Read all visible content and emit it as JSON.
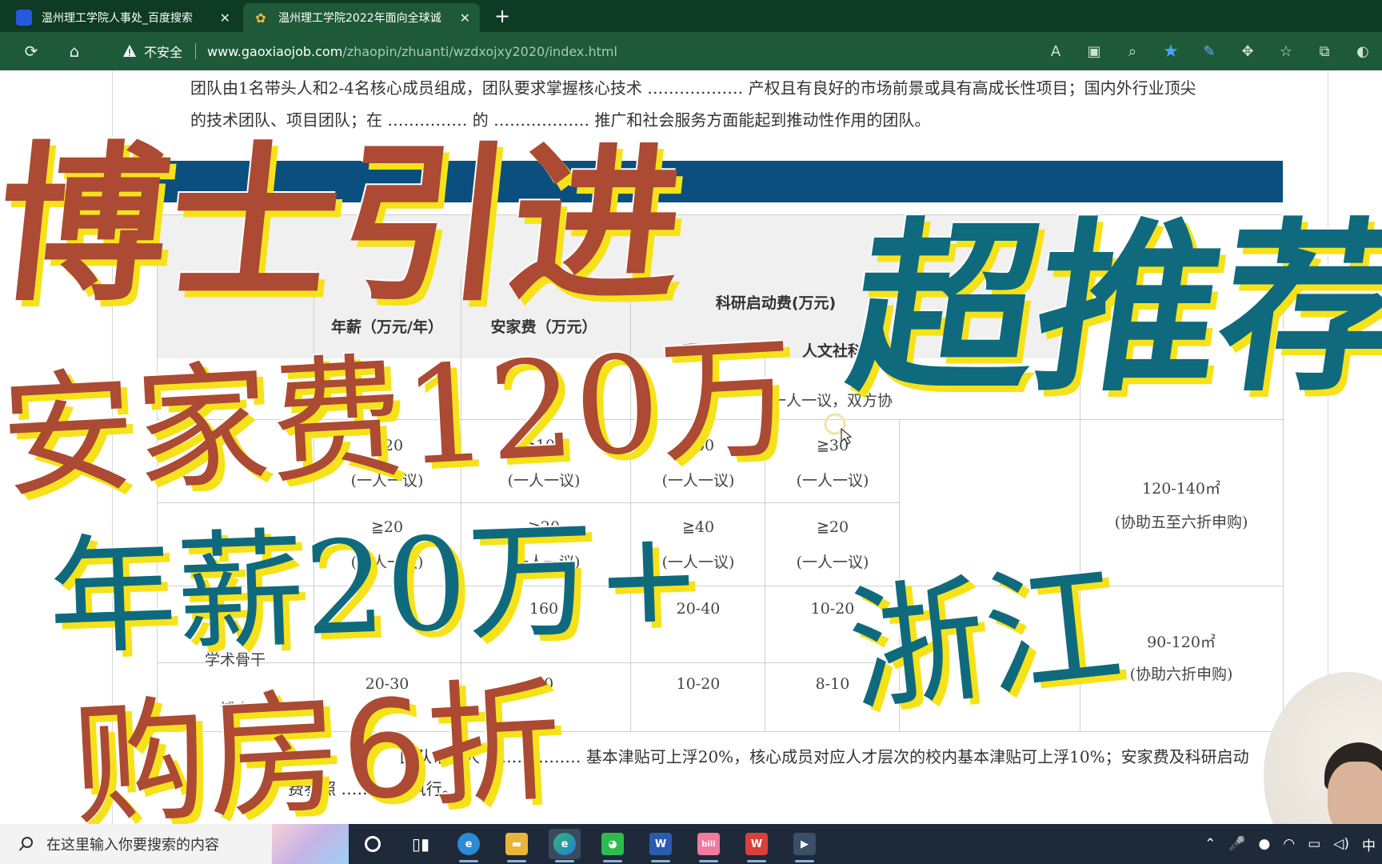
{
  "browser": {
    "tabs": [
      {
        "title": "温州理工学院人事处_百度搜索",
        "favicon": "baidu-icon",
        "active": false
      },
      {
        "title": "温州理工学院2022年面向全球诚",
        "favicon": "peacock-icon",
        "active": true
      }
    ],
    "security_label": "不安全",
    "url_host": "www.gaoxiaojob.com",
    "url_path": "/zhaopin/zhuanti/wzdxojxy2020/index.html"
  },
  "page": {
    "paragraph_1": "团队由1名带头人和2-4名核心成员组成，团队要求掌握核心技术 ……………… 产权且有良好的市场前景或具有高成长性项目；国内外行业顶尖",
    "paragraph_2": "的技术团队、项目团队；在 …………… 的 ……………… 推广和社会服务方面能起到推动性作用的团队。",
    "table": {
      "header": {
        "annual_salary": "年薪（万元/年）",
        "settling": "安家费（万元）",
        "research_fund": "科研启动费(万元)",
        "science": "理工",
        "humanities": "人文社科"
      },
      "row1_note": "一人一议，双方协",
      "rows": [
        {
          "salary": "≧20",
          "salary_note": "(一人一议)",
          "settling": "≧100",
          "settling_note": "(一人一议)",
          "science": "≧60",
          "science_note": "(一人一议)",
          "humanities": "≧30",
          "humanities_note": "(一人一议)",
          "housing": "120-140㎡",
          "housing_note": "(协助五至六折申购)"
        },
        {
          "salary": "≧20",
          "salary_note": "(一人一议)",
          "settling": "≧20",
          "settling_note": "(一人一议)",
          "science": "≧40",
          "science_note": "(一人一议)",
          "humanities": "≧20",
          "humanities_note": "(一人一议)"
        },
        {
          "salary": "",
          "settling": "160",
          "science": "20-40",
          "humanities": "10-20",
          "housing": "90-120㎡",
          "housing_note": "(协助六折申购)"
        },
        {
          "salary": "20-30",
          "settling": "20",
          "science": "10-20",
          "humanities": "8-10"
        }
      ],
      "row_label": "学术骨干",
      "row_label_2": "博士"
    },
    "footer_1": "团队带头人 ……………… 基本津贴可上浮20%，核心成员对应人才层次的校内基本津贴可上浮10%；安家费及科研启动",
    "footer_2": "费参照 ………… 执行。"
  },
  "overlay": {
    "title_main": "博士引进",
    "title_recommend": "超推荐",
    "line_settling": "安家费120万",
    "line_salary": "年薪20万+",
    "line_province": "浙江",
    "line_housing": "购房6折"
  },
  "taskbar": {
    "search_placeholder": "在这里输入你要搜索的内容",
    "apps": [
      "cortana-icon",
      "taskview-icon",
      "app-blue-icon",
      "file-explorer-icon",
      "edge-icon",
      "wechat-icon",
      "word-icon",
      "bilibili-icon",
      "wps-icon",
      "camera-icon"
    ],
    "ime": "中"
  },
  "colors": {
    "tabbar": "#0d3b23",
    "toolbar": "#1e5a3a",
    "banner": "#0a4f7e",
    "overlay_red": "#ac4a33",
    "overlay_teal": "#0f6a7e",
    "overlay_yellow": "#f6e21a"
  }
}
